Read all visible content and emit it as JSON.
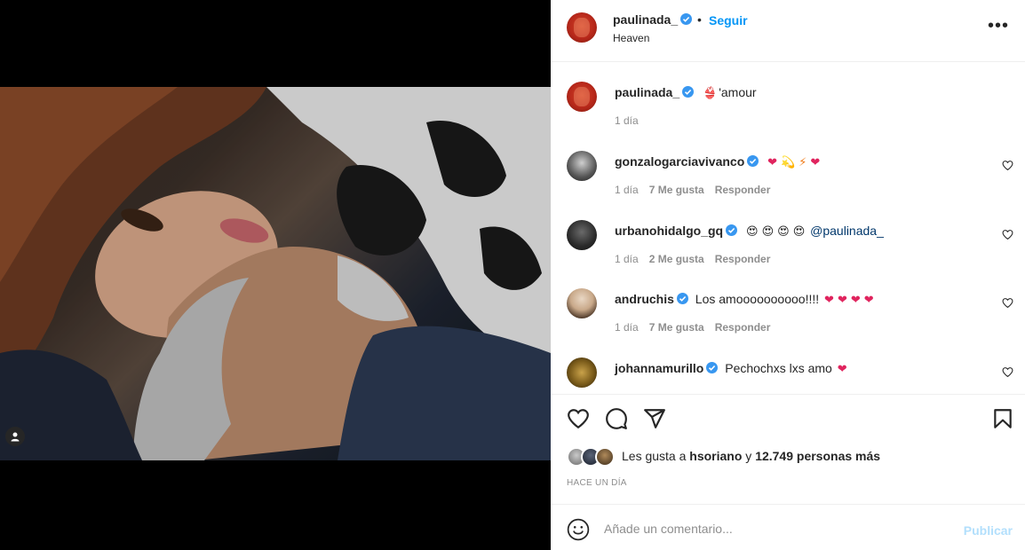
{
  "post": {
    "username": "paulinada_",
    "follow_label": "Seguir",
    "dot": "•",
    "location": "Heaven",
    "more_label": "•••"
  },
  "caption": {
    "username": "paulinada_",
    "text": "'amour",
    "emoji": "👙",
    "time": "1 día"
  },
  "comments": [
    {
      "username": "gonzalogarciavivanco",
      "emojis": [
        "❤",
        "💫",
        "⚡",
        "❤"
      ],
      "text": "",
      "time": "1 día",
      "likes": "7 Me gusta",
      "reply": "Responder"
    },
    {
      "username": "urbanohidalgo_gq",
      "emojis": [
        "😍",
        "😍",
        "😍",
        "😍"
      ],
      "mention": "@paulinada_",
      "time": "1 día",
      "likes": "2 Me gusta",
      "reply": "Responder"
    },
    {
      "username": "andruchis",
      "text": "Los amoooooooooo!!!!",
      "emojis": [
        "❤",
        "❤",
        "❤",
        "❤"
      ],
      "time": "1 día",
      "likes": "7 Me gusta",
      "reply": "Responder"
    },
    {
      "username": "johannamurillo",
      "text": "Pechochxs lxs amo",
      "emojis": [
        "❤"
      ]
    }
  ],
  "likes": {
    "prefix": "Les gusta a",
    "user": "hsoriano",
    "connector": "y",
    "others": "12.749 personas más"
  },
  "time_ago": "HACE UN DÍA",
  "composer": {
    "placeholder": "Añade un comentario...",
    "publish_label": "Publicar"
  },
  "colors": {
    "link_blue": "#0095f6",
    "publish_disabled": "#b2dffc",
    "verified_blue": "#3897f0",
    "heart_red": "#e0245e",
    "secondary_text": "#8e8e8e"
  }
}
